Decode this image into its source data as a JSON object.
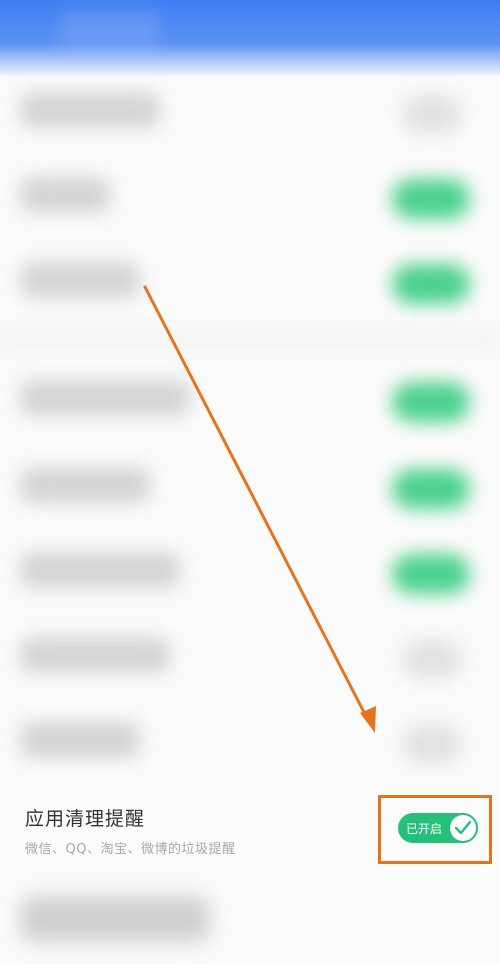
{
  "header": {
    "title": ""
  },
  "settings": {
    "app_cleanup_reminder": {
      "title": "应用清理提醒",
      "subtitle": "微信、QQ、淘宝、微博的垃圾提醒",
      "toggle_label": "已开启",
      "toggle_on": true
    }
  },
  "annotation": {
    "color": "#e8731e",
    "icon": "arrow-down-right",
    "highlight_icon": "check-icon"
  },
  "colors": {
    "header": "#3f7ef3",
    "toggle_on": "#25c07a"
  }
}
